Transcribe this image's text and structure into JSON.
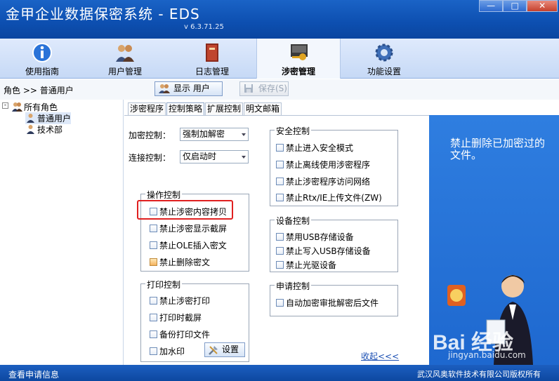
{
  "app": {
    "title": "金甲企业数据保密系统 - EDS",
    "version": "v 6.3.71.25",
    "window_buttons": [
      "—",
      "□",
      "✕"
    ]
  },
  "tabs": [
    {
      "label": "使用指南",
      "icon": "info-icon"
    },
    {
      "label": "用户管理",
      "icon": "users-icon"
    },
    {
      "label": "日志管理",
      "icon": "log-book-icon"
    },
    {
      "label": "涉密管理",
      "icon": "secret-key-icon",
      "active": true
    },
    {
      "label": "功能设置",
      "icon": "gear-icon"
    }
  ],
  "toolbar": {
    "breadcrumb": "角色 >> 普通用户",
    "show_user_label": "显示 用户",
    "save_label": "保存(S)"
  },
  "tree": {
    "root": "所有角色",
    "children": [
      "普通用户",
      "技术部"
    ],
    "expander": "-"
  },
  "subtabs": [
    "涉密程序",
    "控制策略",
    "扩展控制",
    "明文邮箱"
  ],
  "fields": {
    "encrypt_label": "加密控制：",
    "encrypt_value": "强制加解密",
    "connect_label": "连接控制：",
    "connect_value": "仅启动时"
  },
  "groups": {
    "operation": {
      "title": "操作控制",
      "items": [
        "禁止涉密内容拷贝",
        "禁止涉密显示截屏",
        "禁止OLE插入密文",
        "禁止删除密文"
      ]
    },
    "print": {
      "title": "打印控制",
      "items": [
        "禁止涉密打印",
        "打印时截屏",
        "备份打印文件",
        "加水印"
      ],
      "settings_label": "设置"
    },
    "security": {
      "title": "安全控制",
      "items": [
        "禁止进入安全模式",
        "禁止离线使用涉密程序",
        "禁止涉密程序访问网络",
        "禁止Rtx/IE上传文件(ZW)"
      ]
    },
    "device": {
      "title": "设备控制",
      "items": [
        "禁用USB存储设备",
        "禁止写入USB存储设备",
        "禁止光驱设备"
      ]
    },
    "apply": {
      "title": "申请控制",
      "items": [
        "自动加密审批解密后文件"
      ]
    }
  },
  "collapse_link": "收起<<<",
  "promo": {
    "text": "禁止删除已加密过的文件。"
  },
  "status": {
    "left": "查看申请信息",
    "right": "武汉风奥软件技术有限公司版权所有"
  },
  "watermark": {
    "text": "Bai 经验",
    "sub": "jingyan.baidu.com"
  },
  "colors": {
    "title_blue": "#0d4fb0",
    "promo_blue": "#2f7ee0",
    "highlight_red": "#e02020"
  }
}
